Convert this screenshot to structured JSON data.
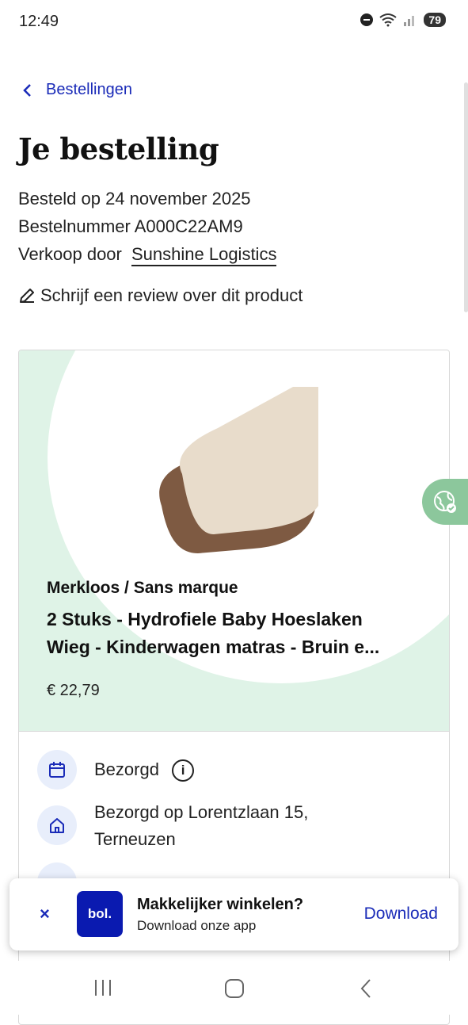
{
  "status": {
    "time": "12:49",
    "battery": "79"
  },
  "nav": {
    "back_label": "Bestellingen"
  },
  "order": {
    "title": "Je bestelling",
    "date_line": "Besteld op 24 november 2025",
    "number_line": "Bestelnummer A000C22AM9",
    "seller_prefix": "Verkoop door",
    "seller_name": "Sunshine Logistics",
    "review_label": "Schrijf een review over dit product"
  },
  "product": {
    "brand": "Merkloos / Sans marque",
    "title_line1": "2 Stuks - Hydrofiele Baby Hoeslaken",
    "title_line2": "Wieg - Kinderwagen matras - Bruin e...",
    "price": "€ 22,79"
  },
  "delivery": {
    "status": "Bezorgd",
    "info_symbol": "i",
    "address_line1": "Bezorgd op Lorentzlaan 15,",
    "address_line2": "Terneuzen"
  },
  "app_banner": {
    "close": "×",
    "logo_text": "bol.",
    "title": "Makkelijker winkelen?",
    "subtitle": "Download onze app",
    "cta": "Download"
  },
  "colors": {
    "accent": "#1a2bb8",
    "card_green": "#dff3e7",
    "globe_green": "#8cc79c"
  },
  "icons": [
    "chevron-left-icon",
    "pencil-icon",
    "calendar-icon",
    "home-icon",
    "globe-icon",
    "close-icon"
  ]
}
